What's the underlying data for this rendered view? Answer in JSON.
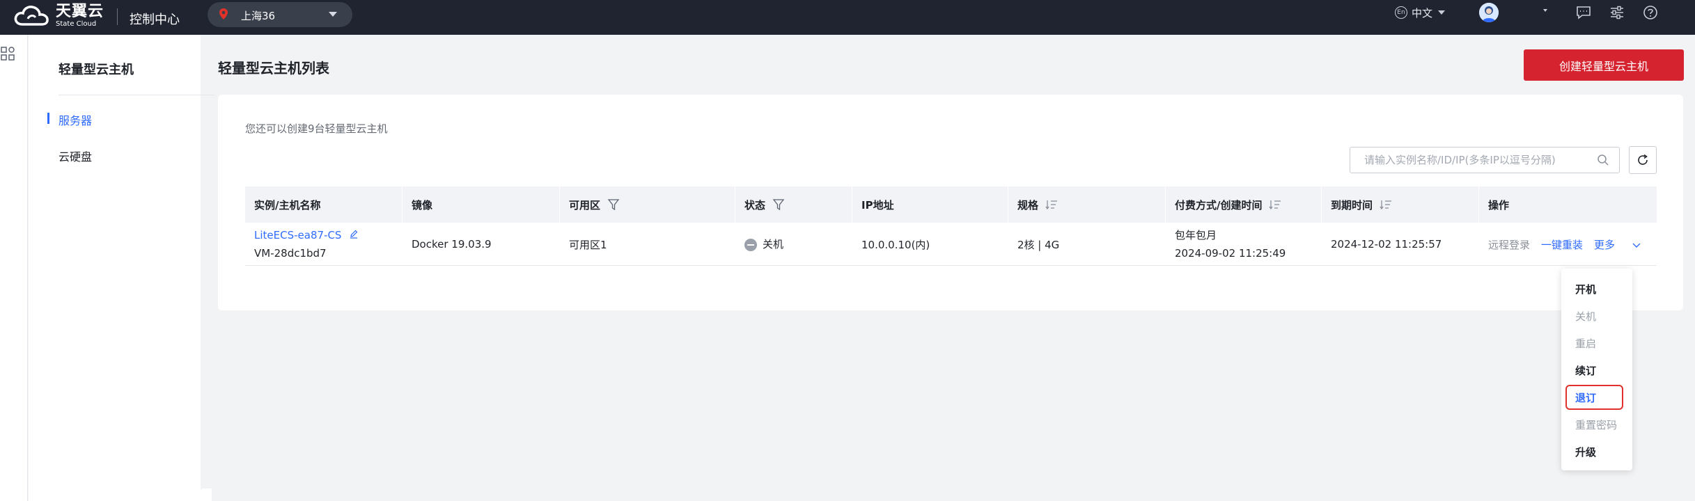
{
  "topbar": {
    "logo_cn": "天翼云",
    "logo_en": "State Cloud",
    "console_title": "控制中心",
    "region": "上海36",
    "language": "中文"
  },
  "sidebar": {
    "title": "轻量型云主机",
    "items": [
      {
        "label": "服务器",
        "active": true
      },
      {
        "label": "云硬盘",
        "active": false
      }
    ]
  },
  "main": {
    "title": "轻量型云主机列表",
    "create_button": "创建轻量型云主机",
    "quota_text": "您还可以创建9台轻量型云主机",
    "search_placeholder": "请输入实例名称/ID/IP(多条IP以逗号分隔)",
    "columns": [
      "实例/主机名称",
      "镜像",
      "可用区",
      "状态",
      "IP地址",
      "规格",
      "付费方式/创建时间",
      "到期时间",
      "操作"
    ],
    "rows": [
      {
        "instance_name": "LiteECS-ea87-CS",
        "host_name": "VM-28dc1bd7",
        "image": "Docker 19.03.9",
        "zone": "可用区1",
        "status": "关机",
        "ip": "10.0.0.10(内)",
        "spec": "2核 | 4G",
        "billing": "包年包月",
        "created": "2024-09-02 11:25:49",
        "expires": "2024-12-02 11:25:57",
        "op_remote": "远程登录",
        "op_reinstall": "一键重装",
        "op_more": "更多"
      }
    ]
  },
  "more_menu": {
    "items": [
      {
        "label": "开机",
        "state": "enabled"
      },
      {
        "label": "关机",
        "state": "disabled"
      },
      {
        "label": "重启",
        "state": "disabled"
      },
      {
        "label": "续订",
        "state": "enabled"
      },
      {
        "label": "退订",
        "state": "selected"
      },
      {
        "label": "重置密码",
        "state": "disabled"
      },
      {
        "label": "升级",
        "state": "enabled"
      }
    ]
  },
  "colors": {
    "topbar_bg": "#1f2430",
    "accent_blue": "#2f6bff",
    "create_red": "#d5232f",
    "highlight_red": "#e0312b"
  }
}
